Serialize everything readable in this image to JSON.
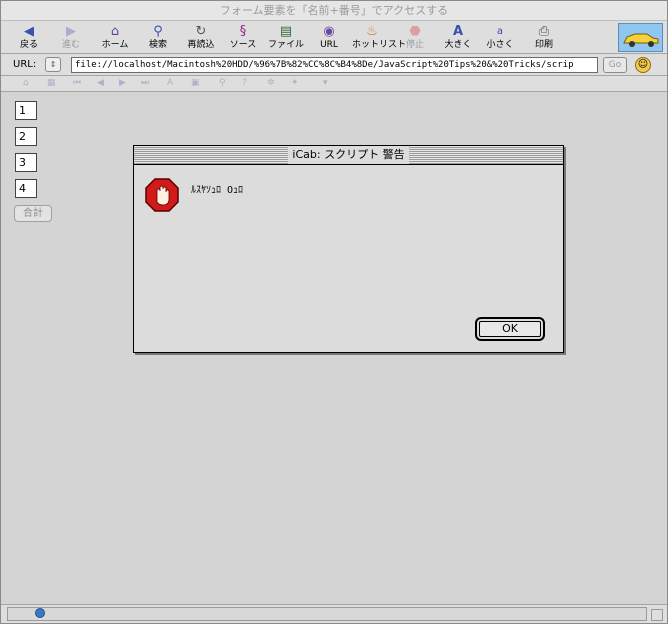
{
  "window": {
    "title": "フォーム要素を「名前+番号」でアクセスする"
  },
  "toolbar": {
    "items": [
      {
        "label": "戻る",
        "icon": "back-arrow-icon"
      },
      {
        "label": "進む",
        "icon": "forward-arrow-icon"
      },
      {
        "label": "ホーム",
        "icon": "home-icon"
      },
      {
        "label": "検索",
        "icon": "search-icon"
      },
      {
        "label": "再読込",
        "icon": "reload-icon"
      },
      {
        "label": "ソース",
        "icon": "source-icon"
      },
      {
        "label": "ファイル",
        "icon": "file-icon"
      },
      {
        "label": "URL",
        "icon": "url-globe-icon"
      },
      {
        "label": "ホットリスト",
        "icon": "hotlist-icon"
      },
      {
        "label": "停止",
        "icon": "stop-icon"
      },
      {
        "label": "大きく",
        "icon": "bigger-text-icon"
      },
      {
        "label": "小さく",
        "icon": "smaller-text-icon"
      },
      {
        "label": "印刷",
        "icon": "print-icon"
      }
    ]
  },
  "urlbar": {
    "label": "URL:",
    "value": "file://localhost/Macintosh%20HDD/%96%7B%82%CC%8C%B4%8De/JavaScript%20Tips%20&%20Tricks/scrip",
    "go_label": "Go"
  },
  "form": {
    "fields": [
      {
        "value": "1"
      },
      {
        "value": "2"
      },
      {
        "value": "3"
      },
      {
        "value": "4"
      }
    ],
    "sum_button_label": "合計"
  },
  "dialog": {
    "title": "iCab: スクリプト 警告",
    "message": "ﾙｽﾔｿｭﾛ Oｭﾛ",
    "ok_label": "OK"
  }
}
